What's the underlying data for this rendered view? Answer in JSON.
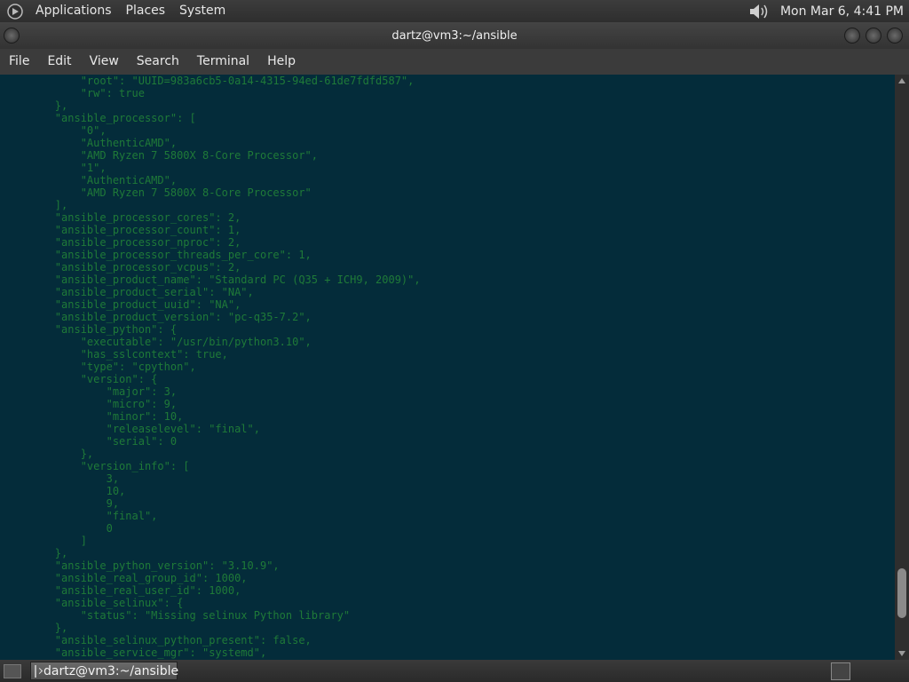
{
  "top_panel": {
    "menus": [
      "Applications",
      "Places",
      "System"
    ],
    "clock": "Mon Mar  6,  4:41 PM"
  },
  "window": {
    "title": "dartz@vm3:~/ansible",
    "menu": [
      "File",
      "Edit",
      "View",
      "Search",
      "Terminal",
      "Help"
    ]
  },
  "terminal": {
    "lines": [
      "            \"root\": \"UUID=983a6cb5-0a14-4315-94ed-61de7fdfd587\",",
      "            \"rw\": true",
      "        },",
      "        \"ansible_processor\": [",
      "            \"0\",",
      "            \"AuthenticAMD\",",
      "            \"AMD Ryzen 7 5800X 8-Core Processor\",",
      "            \"1\",",
      "            \"AuthenticAMD\",",
      "            \"AMD Ryzen 7 5800X 8-Core Processor\"",
      "        ],",
      "        \"ansible_processor_cores\": 2,",
      "        \"ansible_processor_count\": 1,",
      "        \"ansible_processor_nproc\": 2,",
      "        \"ansible_processor_threads_per_core\": 1,",
      "        \"ansible_processor_vcpus\": 2,",
      "        \"ansible_product_name\": \"Standard PC (Q35 + ICH9, 2009)\",",
      "        \"ansible_product_serial\": \"NA\",",
      "        \"ansible_product_uuid\": \"NA\",",
      "        \"ansible_product_version\": \"pc-q35-7.2\",",
      "        \"ansible_python\": {",
      "            \"executable\": \"/usr/bin/python3.10\",",
      "            \"has_sslcontext\": true,",
      "            \"type\": \"cpython\",",
      "            \"version\": {",
      "                \"major\": 3,",
      "                \"micro\": 9,",
      "                \"minor\": 10,",
      "                \"releaselevel\": \"final\",",
      "                \"serial\": 0",
      "            },",
      "            \"version_info\": [",
      "                3,",
      "                10,",
      "                9,",
      "                \"final\",",
      "                0",
      "            ]",
      "        },",
      "        \"ansible_python_version\": \"3.10.9\",",
      "        \"ansible_real_group_id\": 1000,",
      "        \"ansible_real_user_id\": 1000,",
      "        \"ansible_selinux\": {",
      "            \"status\": \"Missing selinux Python library\"",
      "        },",
      "        \"ansible_selinux_python_present\": false,",
      "        \"ansible_service_mgr\": \"systemd\","
    ]
  },
  "taskbar": {
    "item_label": "dartz@vm3:~/ansible"
  },
  "colors": {
    "terminal_bg": "#042c3a",
    "terminal_fg": "#1f7a38"
  }
}
